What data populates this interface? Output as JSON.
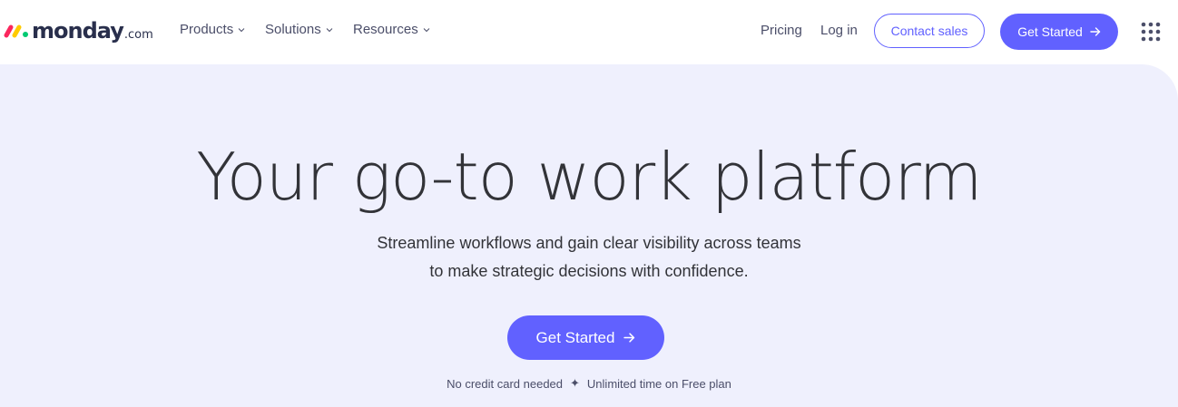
{
  "header": {
    "logo": {
      "word": "monday",
      "suffix": ".com"
    },
    "nav": [
      {
        "label": "Products"
      },
      {
        "label": "Solutions"
      },
      {
        "label": "Resources"
      }
    ],
    "pricing_label": "Pricing",
    "login_label": "Log in",
    "contact_sales_label": "Contact sales",
    "get_started_label": "Get Started"
  },
  "hero": {
    "title": "Your go-to work platform",
    "subtitle_line1": "Streamline workflows and gain clear visibility across teams",
    "subtitle_line2": "to make strategic decisions with confidence.",
    "cta_label": "Get Started",
    "footnote_left": "No credit card needed",
    "footnote_separator": "✦",
    "footnote_right": "Unlimited time on Free plan"
  },
  "colors": {
    "brand_purple": "#6161ff",
    "hero_background": "#eff0fd",
    "text_dark": "#323338",
    "logo_red": "#fb275d",
    "logo_yellow": "#ffcb00",
    "logo_green": "#00ca72"
  },
  "icons": {
    "chevron": "chevron-down-icon",
    "arrow": "arrow-right-icon",
    "apps": "apps-grid-icon",
    "sparkle": "sparkle-icon"
  }
}
